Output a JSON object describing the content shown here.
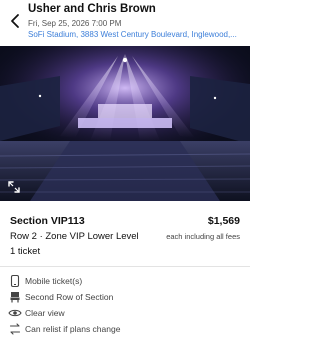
{
  "event": {
    "title": "Usher and Chris Brown",
    "date": "Fri, Sep 25, 2026 7:00 PM",
    "venue": "SoFi Stadium, 3883 West Century Boulevard, Inglewood,..."
  },
  "listing": {
    "section": "Section VIP113",
    "price": "$1,569",
    "row_zone": "Row 2 · Zone VIP Lower Level",
    "fee_note": "each including all fees",
    "quantity": "1 ticket"
  },
  "features": [
    {
      "label": "Mobile ticket(s)",
      "icon": "mobile-phone-icon"
    },
    {
      "label": "Second Row of Section",
      "icon": "seat-icon"
    },
    {
      "label": "Clear view",
      "icon": "eye-icon"
    },
    {
      "label": "Can relist if plans change",
      "icon": "relist-icon"
    }
  ],
  "colors": {
    "link": "#3d7fd9",
    "stage_lights": "#b98cff"
  }
}
